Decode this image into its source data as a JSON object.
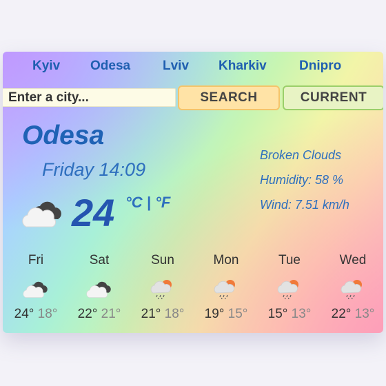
{
  "nav": {
    "cities": [
      "Kyiv",
      "Odesa",
      "Lviv",
      "Kharkiv",
      "Dnipro"
    ]
  },
  "search": {
    "placeholder": "Enter a city...",
    "value": "",
    "search_label": "SEARCH",
    "current_label": "CURRENT"
  },
  "current": {
    "city": "Odesa",
    "datetime": "Friday 14:09",
    "temperature": "24",
    "unit_celsius": "°C",
    "unit_separator": " | ",
    "unit_fahrenheit": "°F",
    "icon": "broken-clouds-icon",
    "description": "Broken Clouds",
    "humidity": "Humidity: 58 %",
    "wind": "Wind: 7.51 km/h"
  },
  "forecast": [
    {
      "day": "Fri",
      "high": "24°",
      "low": "18°",
      "icon": "clouds-icon"
    },
    {
      "day": "Sat",
      "high": "22°",
      "low": "21°",
      "icon": "clouds-icon"
    },
    {
      "day": "Sun",
      "high": "21°",
      "low": "18°",
      "icon": "rain-icon"
    },
    {
      "day": "Mon",
      "high": "19°",
      "low": "15°",
      "icon": "rain-icon"
    },
    {
      "day": "Tue",
      "high": "15°",
      "low": "13°",
      "icon": "rain-icon"
    },
    {
      "day": "Wed",
      "high": "22°",
      "low": "13°",
      "icon": "rain-icon"
    }
  ],
  "colors": {
    "link": "#1f5fb0",
    "title": "#1f62b5",
    "temperature": "#2555b0",
    "search_button": "#ffe3a6",
    "current_button": "#e8f3c4"
  }
}
